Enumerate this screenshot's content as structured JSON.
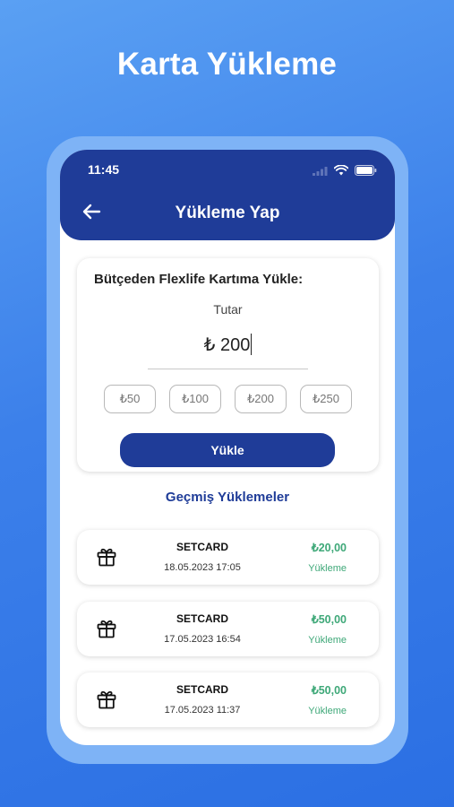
{
  "promo": {
    "title": "Karta Yükleme"
  },
  "status_bar": {
    "time": "11:45"
  },
  "header": {
    "title": "Yükleme Yap",
    "back_icon": "arrow-left-icon"
  },
  "topup": {
    "heading": "Bütçeden Flexlife Kartıma Yükle:",
    "amount_label": "Tutar",
    "amount_value": "₺ 200",
    "quick_amounts": [
      "₺50",
      "₺100",
      "₺200",
      "₺250"
    ],
    "submit_label": "Yükle"
  },
  "history": {
    "title": "Geçmiş Yüklemeler",
    "items": [
      {
        "icon": "gift-icon",
        "name": "SETCARD",
        "date": "18.05.2023 17:05",
        "amount": "₺20,00",
        "type": "Yükleme"
      },
      {
        "icon": "gift-icon",
        "name": "SETCARD",
        "date": "17.05.2023 16:54",
        "amount": "₺50,00",
        "type": "Yükleme"
      },
      {
        "icon": "gift-icon",
        "name": "SETCARD",
        "date": "17.05.2023 11:37",
        "amount": "₺50,00",
        "type": "Yükleme"
      }
    ]
  },
  "colors": {
    "brand": "#1f3c98",
    "success": "#3ea878",
    "background": "#3c80ea"
  }
}
